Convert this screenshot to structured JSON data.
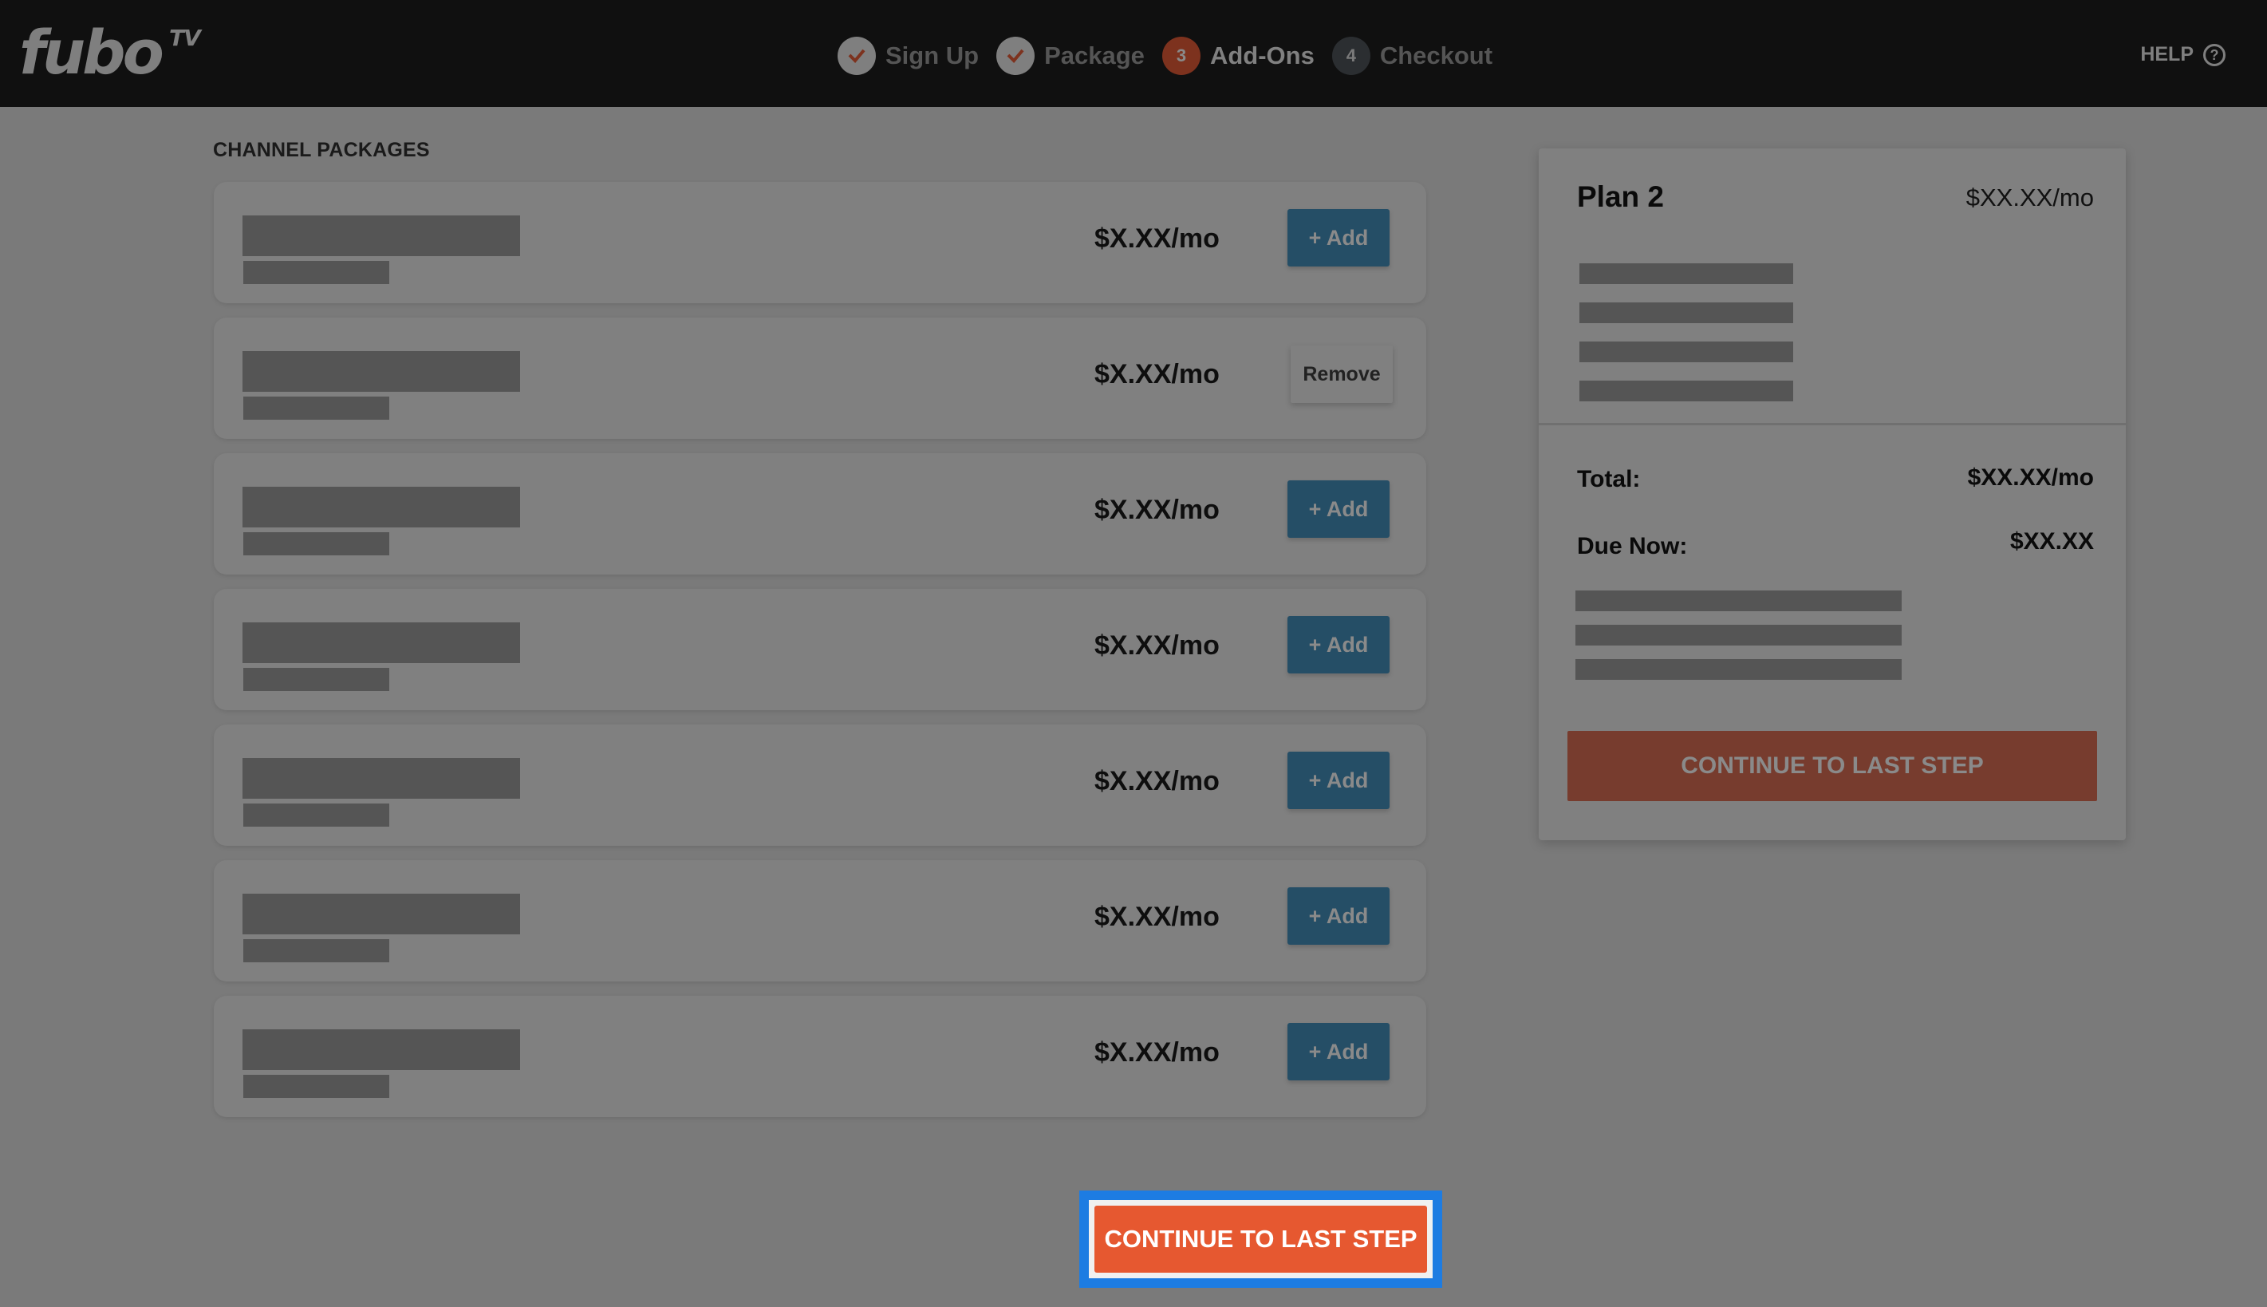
{
  "header": {
    "logo_main": "fubo",
    "logo_sup": "TV",
    "help_label": "HELP",
    "help_icon": "question-circle-icon",
    "steps": [
      {
        "label": "Sign Up",
        "state": "done",
        "marker": "✓"
      },
      {
        "label": "Package",
        "state": "done",
        "marker": "✓"
      },
      {
        "label": "Add-Ons",
        "state": "active",
        "marker": "3"
      },
      {
        "label": "Checkout",
        "state": "todo",
        "marker": "4"
      }
    ]
  },
  "main": {
    "section_title": "CHANNEL PACKAGES",
    "packages": [
      {
        "price": "$X.XX/mo",
        "action": "+ Add",
        "added": false
      },
      {
        "price": "$X.XX/mo",
        "action": "Remove",
        "added": true
      },
      {
        "price": "$X.XX/mo",
        "action": "+ Add",
        "added": false
      },
      {
        "price": "$X.XX/mo",
        "action": "+ Add",
        "added": false
      },
      {
        "price": "$X.XX/mo",
        "action": "+ Add",
        "added": false
      },
      {
        "price": "$X.XX/mo",
        "action": "+ Add",
        "added": false
      },
      {
        "price": "$X.XX/mo",
        "action": "+ Add",
        "added": false
      }
    ],
    "continue_label": "CONTINUE TO LAST STEP"
  },
  "summary": {
    "plan_name": "Plan 2",
    "plan_price": "$XX.XX/mo",
    "total_label": "Total:",
    "total_value": "$XX.XX/mo",
    "due_label": "Due Now:",
    "due_value": "$XX.XX",
    "continue_label": "CONTINUE TO LAST STEP"
  },
  "colors": {
    "accent_orange": "#e65830",
    "add_button_blue": "#254e66",
    "focus_ring": "#1d7ce2",
    "header_bg": "#101010"
  }
}
